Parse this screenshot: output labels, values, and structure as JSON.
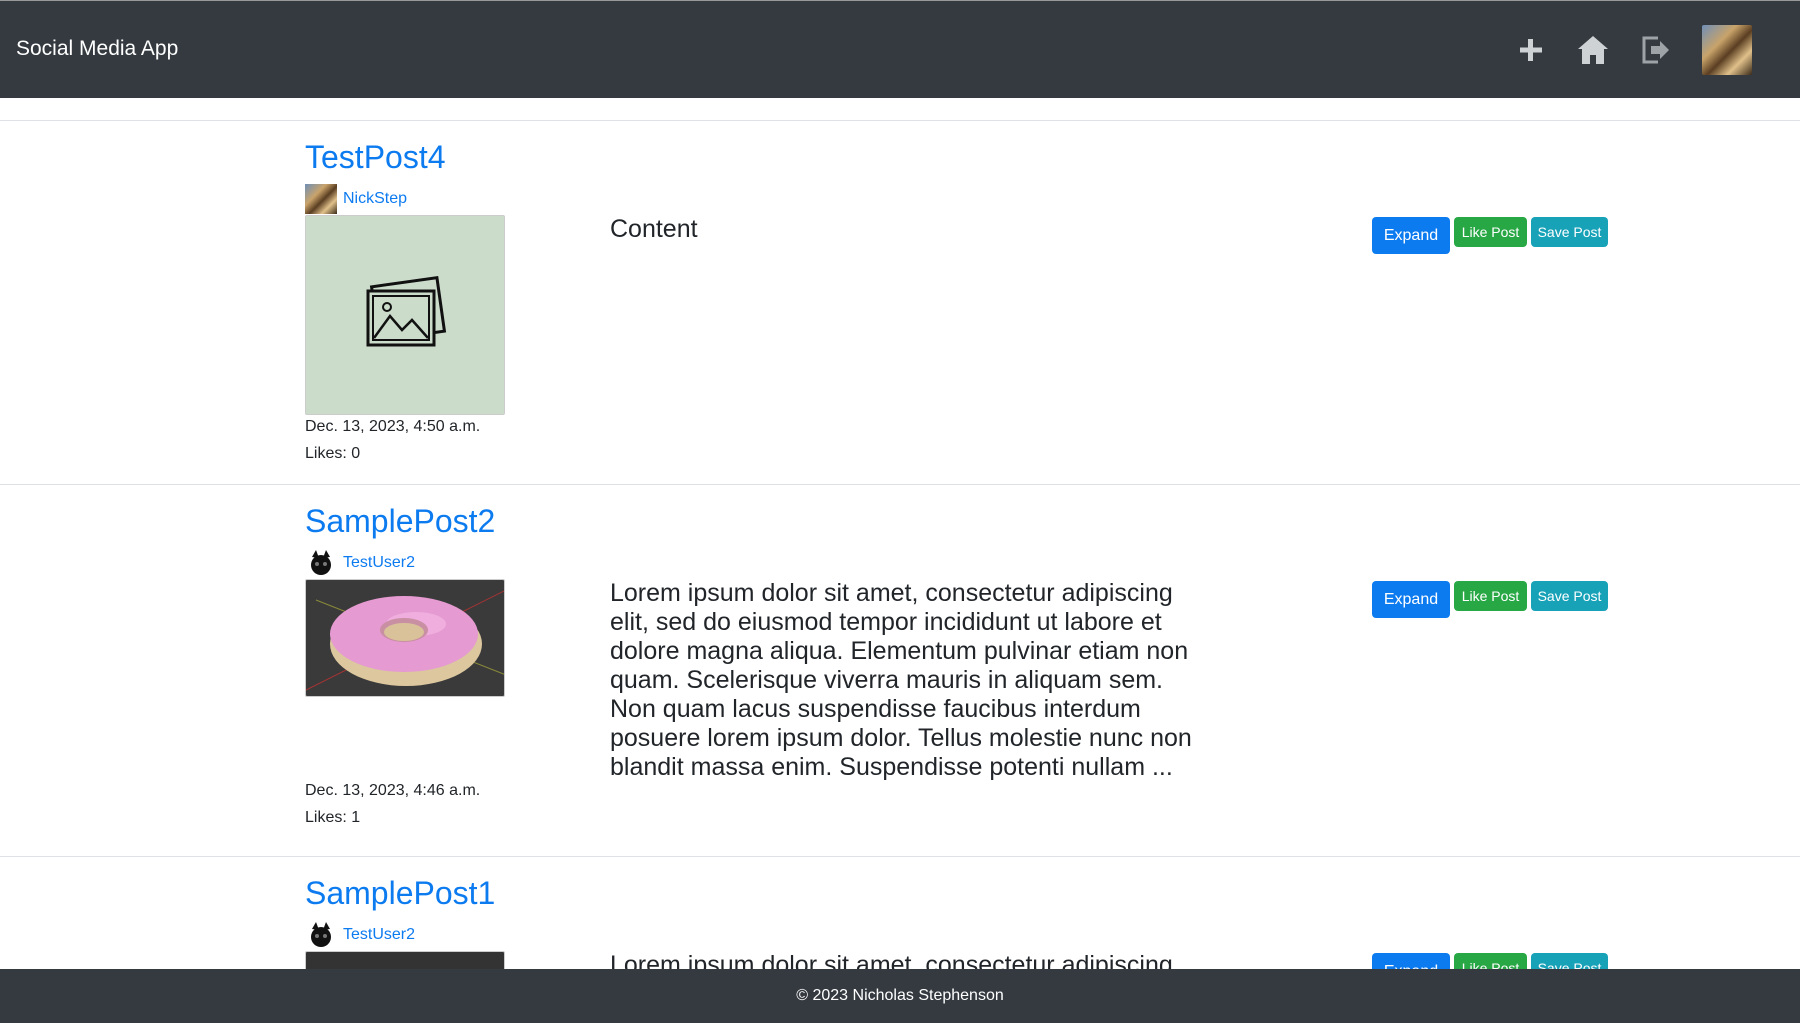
{
  "app": {
    "brand": "Social Media App"
  },
  "nav": {
    "icons": [
      "plus-icon",
      "home-icon",
      "logout-icon"
    ]
  },
  "colors": {
    "navbar": "#343a40",
    "primary": "#0d7bf0",
    "success": "#28a745",
    "info": "#17a2b8"
  },
  "posts": [
    {
      "title": "TestPost4",
      "author": "NickStep",
      "content": "Content",
      "date": "Dec. 13, 2023, 4:50 a.m.",
      "likes": "Likes: 0",
      "image": "placeholder-image-icon",
      "buttons": {
        "expand": "Expand",
        "like": "Like Post",
        "save": "Save Post"
      }
    },
    {
      "title": "SamplePost2",
      "author": "TestUser2",
      "content": "Lorem ipsum dolor sit amet, consectetur adipiscing elit, sed do eiusmod tempor incididunt ut labore et dolore magna aliqua. Elementum pulvinar etiam non quam. Scelerisque viverra mauris in aliquam sem. Non quam lacus suspendisse faucibus interdum posuere lorem ipsum dolor. Tellus molestie nunc non blandit massa enim. Suspendisse potenti nullam ...",
      "date": "Dec. 13, 2023, 4:46 a.m.",
      "likes": "Likes: 1",
      "image": "donut-render",
      "buttons": {
        "expand": "Expand",
        "like": "Like Post",
        "save": "Save Post"
      }
    },
    {
      "title": "SamplePost1",
      "author": "TestUser2",
      "content": "Lorem ipsum dolor sit amet, consectetur adipiscing",
      "buttons": {
        "expand": "Expand",
        "like": "Like Post",
        "save": "Save Post"
      }
    }
  ],
  "footer": {
    "text": "© 2023 Nicholas Stephenson"
  }
}
